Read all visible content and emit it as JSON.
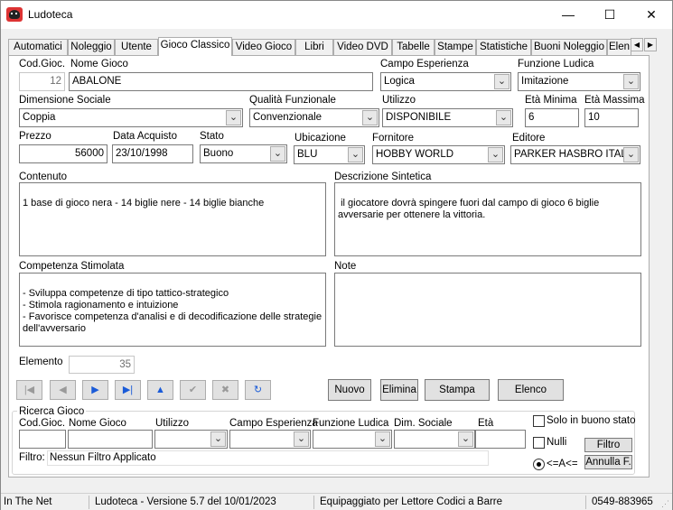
{
  "window": {
    "title": "Ludoteca",
    "minimize": "—",
    "maximize": "☐",
    "close": "✕"
  },
  "tabs": [
    {
      "label": "Automatici"
    },
    {
      "label": "Noleggio"
    },
    {
      "label": "Utente"
    },
    {
      "label": "Gioco Classico",
      "active": true
    },
    {
      "label": "Video Gioco"
    },
    {
      "label": "Libri"
    },
    {
      "label": "Video DVD"
    },
    {
      "label": "Tabelle"
    },
    {
      "label": "Stampe"
    },
    {
      "label": "Statistiche"
    },
    {
      "label": "Buoni Noleggio"
    },
    {
      "label": "Elen"
    }
  ],
  "tab_scroll": {
    "left": "◀",
    "right": "▶"
  },
  "form": {
    "cod_gioc_label": "Cod.Gioc.",
    "cod_gioc": "12",
    "nome_gioco_label": "Nome Gioco",
    "nome_gioco": "ABALONE",
    "campo_esperienza_label": "Campo Esperienza",
    "campo_esperienza": "Logica",
    "funzione_ludica_label": "Funzione Ludica",
    "funzione_ludica": "Imitazione",
    "dimensione_sociale_label": "Dimensione Sociale",
    "dimensione_sociale": "Coppia",
    "qualita_funzionale_label": "Qualità Funzionale",
    "qualita_funzionale": "Convenzionale",
    "utilizzo_label": "Utilizzo",
    "utilizzo": "DISPONIBILE",
    "eta_minima_label": "Età Minima",
    "eta_minima": "6",
    "eta_massima_label": "Età Massima",
    "eta_massima": "10",
    "prezzo_label": "Prezzo",
    "prezzo": "56000",
    "data_acquisto_label": "Data Acquisto",
    "data_acquisto": "23/10/1998",
    "stato_label": "Stato",
    "stato": "Buono",
    "ubicazione_label": "Ubicazione",
    "ubicazione": "BLU",
    "fornitore_label": "Fornitore",
    "fornitore": "HOBBY WORLD",
    "editore_label": "Editore",
    "editore": "PARKER HASBRO ITALY",
    "contenuto_label": "Contenuto",
    "contenuto": "1 base di gioco nera - 14 biglie nere - 14 biglie bianche",
    "descrizione_label": "Descrizione Sintetica",
    "descrizione": " il giocatore dovrà spingere fuori dal campo di gioco 6 biglie avversarie per ottenere la vittoria.",
    "competenza_label": "Competenza Stimolata",
    "competenza": "- Sviluppa competenze di tipo tattico-strategico\n- Stimola ragionamento e intuizione\n- Favorisce competenza d'analisi e di decodificazione delle strategie dell'avversario",
    "note_label": "Note",
    "note": "",
    "elemento_label": "Elemento",
    "elemento": "35"
  },
  "nav": {
    "first": "|◀",
    "prev": "◀",
    "next": "▶",
    "last": "▶|",
    "up": "▲",
    "confirm": "✔",
    "cancel": "✖",
    "refresh": "↻"
  },
  "buttons": {
    "nuovo": "Nuovo",
    "elimina": "Elimina",
    "stampa": "Stampa",
    "elenco": "Elenco"
  },
  "ricerca": {
    "title": "Ricerca Gioco",
    "cod_label": "Cod.Gioc.",
    "nome_label": "Nome Gioco",
    "utilizzo_label": "Utilizzo",
    "campo_label": "Campo Esperienza",
    "funzione_label": "Funzione Ludica",
    "dim_label": "Dim. Sociale",
    "eta_label": "Età",
    "solo_buono_label": "Solo in buono stato",
    "nulli_label": "Nulli",
    "filtro_button": "Filtro",
    "annulla_button": "Annulla F.",
    "range_label": "<=A<=",
    "filtro_label": "Filtro:",
    "filtro_value": "Nessun Filtro Applicato"
  },
  "statusbar": {
    "net": "In The Net",
    "version": "Ludoteca - Versione 5.7 del 10/01/2023",
    "equip": "Equipaggiato per Lettore Codici a Barre",
    "phone": "0549-883965"
  },
  "icons": {
    "app": "game-controller-icon",
    "dropdown": "chevron-down-icon"
  }
}
